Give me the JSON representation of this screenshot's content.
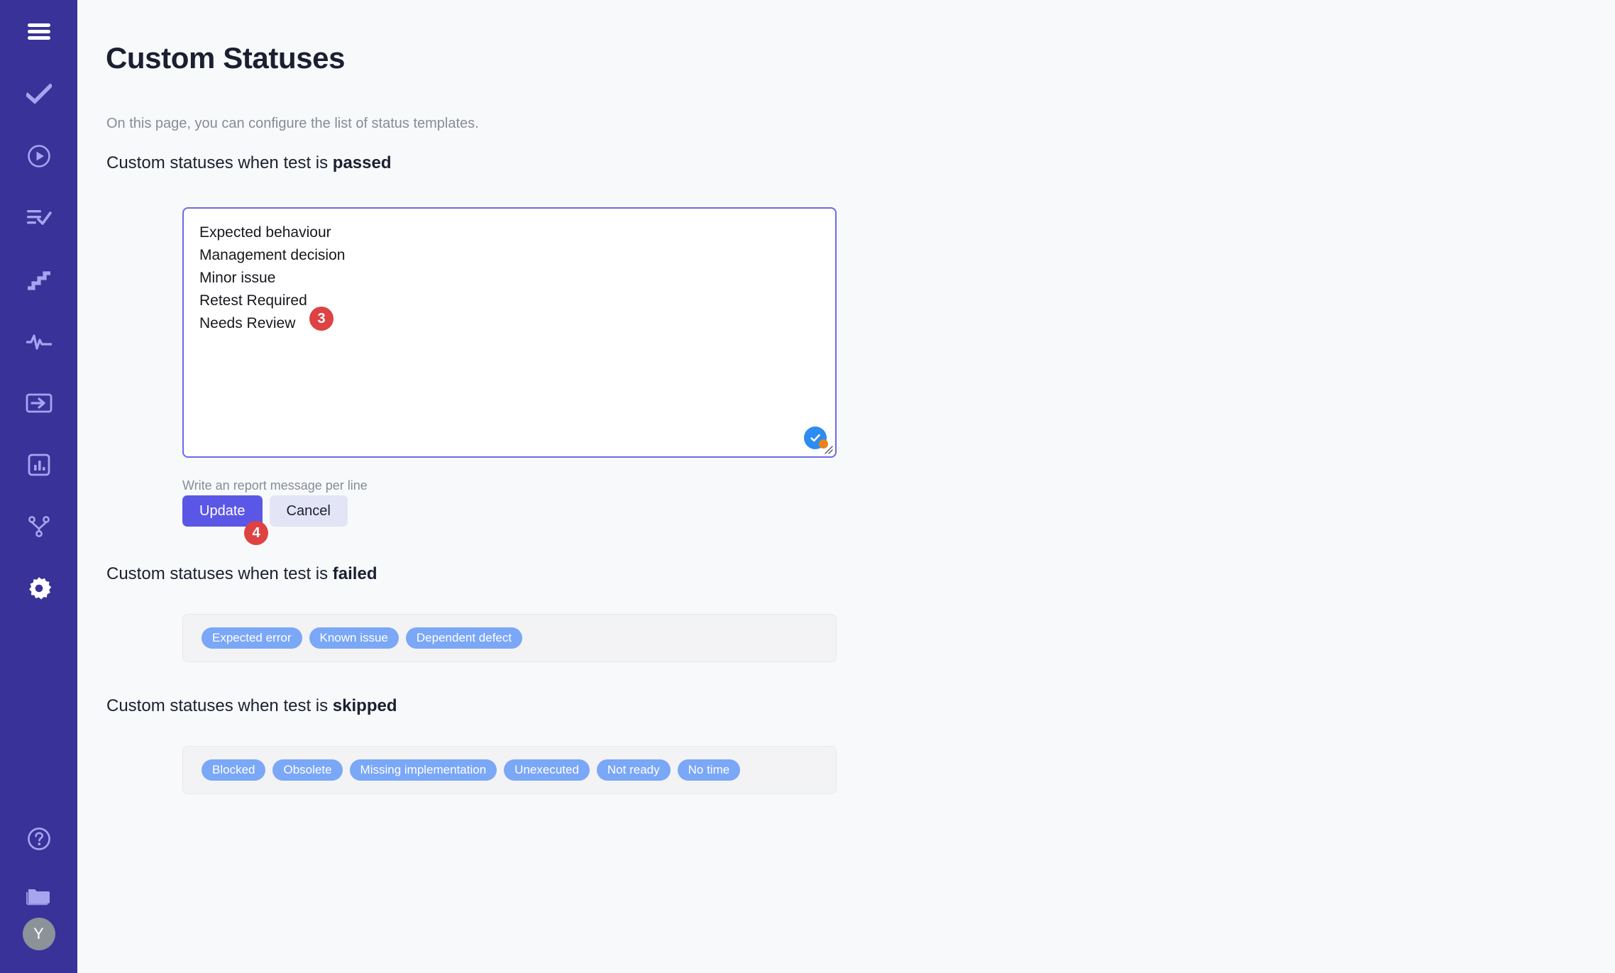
{
  "sidebar": {
    "items": [
      {
        "name": "menu-toggle",
        "icon": "hamburger-icon",
        "tone": "bright"
      },
      {
        "name": "tests-check",
        "icon": "check-icon",
        "tone": "dim"
      },
      {
        "name": "launches",
        "icon": "play-circle-icon",
        "tone": "dim"
      },
      {
        "name": "test-plans",
        "icon": "list-check-icon",
        "tone": "dim"
      },
      {
        "name": "milestones",
        "icon": "stairs-icon",
        "tone": "dim"
      },
      {
        "name": "activity",
        "icon": "pulse-icon",
        "tone": "dim"
      },
      {
        "name": "import",
        "icon": "import-box-icon",
        "tone": "dim"
      },
      {
        "name": "reports",
        "icon": "bar-chart-icon",
        "tone": "dim"
      },
      {
        "name": "integrations",
        "icon": "git-merge-icon",
        "tone": "dim"
      },
      {
        "name": "settings",
        "icon": "gear-icon",
        "tone": "bright"
      },
      {
        "name": "help",
        "icon": "question-circle-icon",
        "tone": "dim"
      },
      {
        "name": "projects",
        "icon": "folders-icon",
        "tone": "dim"
      }
    ],
    "avatar_initial": "Y",
    "colors": {
      "background": "#383299",
      "icon_dim": "#A7A4F0",
      "icon_bright": "#FFFFFF",
      "avatar_background": "#8B9399"
    }
  },
  "page": {
    "title": "Custom Statuses",
    "subtitle": "On this page, you can configure the list of status templates."
  },
  "passed_section": {
    "heading_prefix": "Custom statuses when test is ",
    "heading_emphasis": "passed",
    "textarea_value": "Expected behaviour\nManagement decision\nMinor issue\nRetest Required\nNeeds Review",
    "textarea_lines": [
      "Expected behaviour",
      "Management decision",
      "Minor issue",
      "Retest Required",
      "Needs Review"
    ],
    "hint": "Write an report message per line",
    "update_label": "Update",
    "cancel_label": "Cancel",
    "assistant_badge_icon": "blue-check-circle-icon",
    "resize_handle_icon": "resize-grip-icon",
    "colors": {
      "textarea_border": "#6C6AE8",
      "update_button": "#5B57E6",
      "cancel_button": "#E3E4F6"
    }
  },
  "failed_section": {
    "heading_prefix": "Custom statuses when test is ",
    "heading_emphasis": "failed",
    "chips": [
      "Expected error",
      "Known issue",
      "Dependent defect"
    ]
  },
  "skipped_section": {
    "heading_prefix": "Custom statuses when test is ",
    "heading_emphasis": "skipped",
    "chips": [
      "Blocked",
      "Obsolete",
      "Missing implementation",
      "Unexecuted",
      "Not ready",
      "No time"
    ]
  },
  "markers": [
    {
      "label": "3",
      "target": "textarea-needs-review-line"
    },
    {
      "label": "4",
      "target": "update-button"
    }
  ],
  "theme": {
    "page_background": "#F8F9FA",
    "chip_background": "#7BA7F7",
    "chip_container_background": "#F3F3F5",
    "marker_background": "#DE4242",
    "text_primary": "#1A2031",
    "text_muted": "#868C96"
  }
}
